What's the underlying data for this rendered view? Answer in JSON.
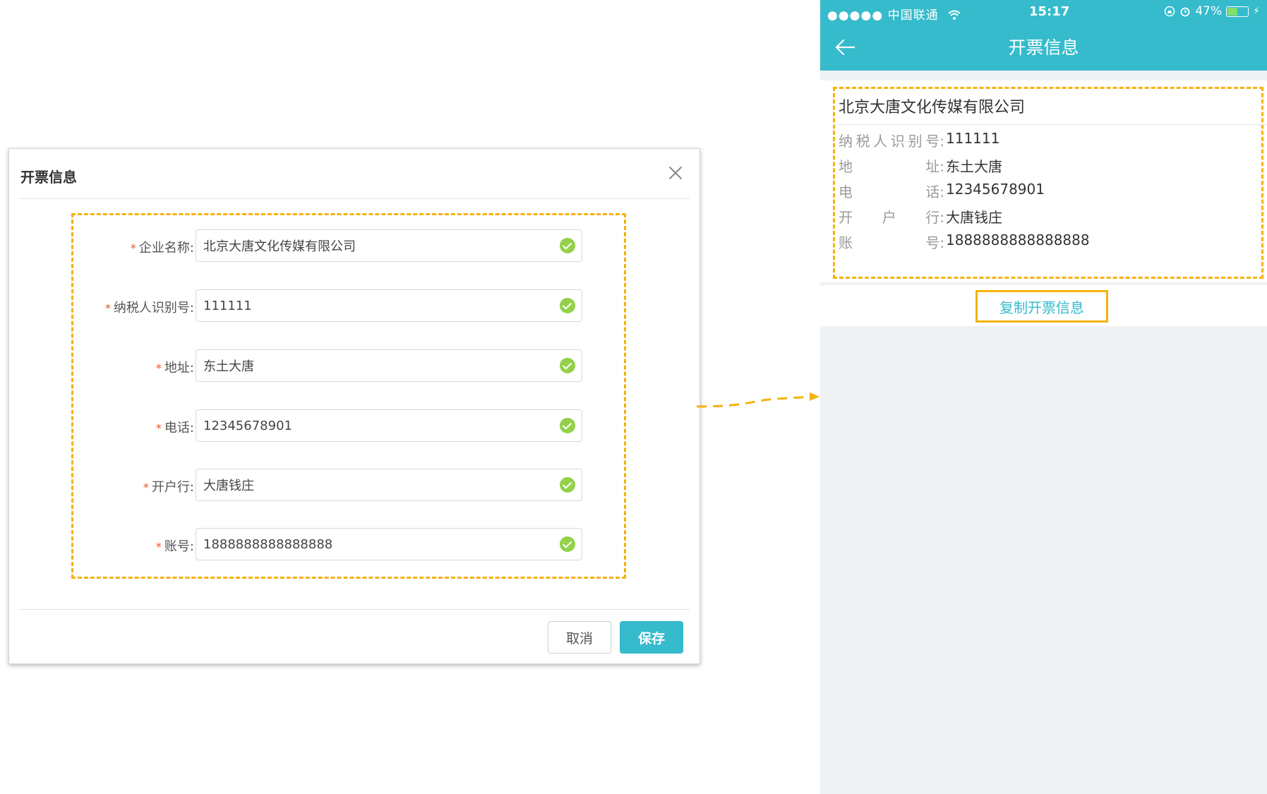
{
  "dialog": {
    "title": "开票信息",
    "fields": [
      {
        "label": "企业名称:",
        "value": "北京大唐文化传媒有限公司"
      },
      {
        "label": "纳税人识别号:",
        "value": "111111"
      },
      {
        "label": "地址:",
        "value": "东土大唐"
      },
      {
        "label": "电话:",
        "value": "12345678901"
      },
      {
        "label": "开户行:",
        "value": "大唐钱庄"
      },
      {
        "label": "账号:",
        "value": "1888888888888888"
      }
    ],
    "required_mark": "*",
    "cancel_label": "取消",
    "save_label": "保存"
  },
  "phone": {
    "status_bar": {
      "signal": "●●●●● 中国联通",
      "time": "15:17",
      "battery": "47%",
      "battery_level": 0.47
    },
    "nav_title": "开票信息",
    "company_name": "北京大唐文化传媒有限公司",
    "rows": [
      {
        "label": [
          "纳",
          "税",
          "人",
          "识",
          "别",
          "号:"
        ],
        "value": "111111"
      },
      {
        "label": [
          "地",
          "址:"
        ],
        "value": "东土大唐"
      },
      {
        "label": [
          "电",
          "话:"
        ],
        "value": "12345678901"
      },
      {
        "label": [
          "开",
          "户",
          "行:"
        ],
        "value": "大唐钱庄"
      },
      {
        "label": [
          "账",
          "号:"
        ],
        "value": "1888888888888888"
      }
    ],
    "copy_button_label": "复制开票信息"
  },
  "colors": {
    "accent": "#35bbcc",
    "highlight": "#f5b20e",
    "required": "#e9541c",
    "valid": "#93d149"
  },
  "icons": [
    "close-icon",
    "check-icon",
    "back-arrow-icon",
    "wifi-icon",
    "alarm-icon",
    "battery-icon"
  ]
}
